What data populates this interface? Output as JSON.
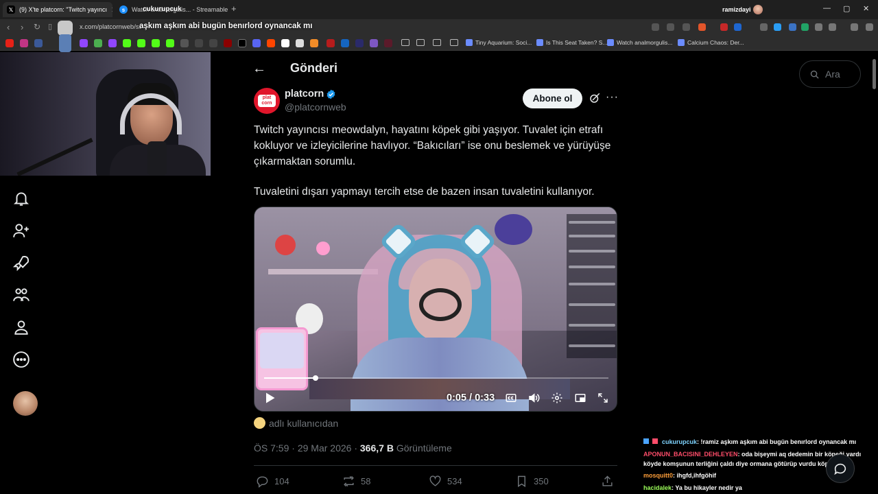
{
  "browser": {
    "tabs": [
      {
        "title": "(9) X'te platcorn: \"Twitch yayıncı",
        "favicon": "x-logo-icon",
        "active": true
      },
      {
        "title": "Watch analmorgulis... - Streamable",
        "favicon": "streamable-icon",
        "active": false
      }
    ],
    "new_tab_label": "+",
    "profile_name": "ramizdayi",
    "window_controls": [
      "—",
      "▢",
      "✕"
    ],
    "url": "x.com/platcornweb/st",
    "bookmarks": [
      {
        "label": "Tiny Aquarium: Soci..."
      },
      {
        "label": "Is This Seat Taken? S..."
      },
      {
        "label": "Watch analmorgulis..."
      },
      {
        "label": "Calcium Chaos: Der..."
      }
    ]
  },
  "stream_overlay": {
    "streamer": "cukurupcuk",
    "title": "aşkım aşkım abi bugün benırlord oynancak mı"
  },
  "sidebar": {
    "items": [
      {
        "name": "notifications",
        "icon": "bell-icon"
      },
      {
        "name": "follow",
        "icon": "add-person-icon"
      },
      {
        "name": "premium",
        "icon": "rocket-icon"
      },
      {
        "name": "communities",
        "icon": "people-icon"
      },
      {
        "name": "profile",
        "icon": "person-icon"
      },
      {
        "name": "more",
        "icon": "more-circle-icon"
      }
    ]
  },
  "header": {
    "title": "Gönderi"
  },
  "tweet": {
    "author_name": "platcorn",
    "author_handle": "@platcornweb",
    "avatar_text": "plat corn",
    "subscribe_label": "Abone ol",
    "paragraph_1": "Twitch yayıncısı meowdalyn, hayatını köpek gibi yaşıyor. Tuvalet için etrafı kokluyor ve izleyicilerine havlıyor. “Bakıcıları” ise onu beslemek ve yürüyüşe çıkarmaktan sorumlu.",
    "paragraph_2": "Tuvaletini dışarı yapmayı tercih etse de bazen insan tuvaletini kullanıyor.",
    "video_time": "0:05 / 0:33",
    "video_progress": 0.15,
    "from_user": "adlı kullanıcıdan",
    "time": "ÖS 7:59",
    "date": "29 Mar 2026",
    "views_count": "366,7 B",
    "views_label": "Görüntüleme",
    "replies": "104",
    "reposts": "58",
    "likes": "534",
    "bookmarks": "350"
  },
  "search": {
    "placeholder": "Ara"
  },
  "chat": [
    {
      "user": "cukurupcuk",
      "user_color": "#7fd4ff",
      "text": ": !ramiz aşkım aşkım abi bugün benırlord oynancak mı"
    },
    {
      "user": "APONUN_BACISINI_DEHLEYEN",
      "user_color": "#ff4d6a",
      "text": ": oda bişeymi aq dedemin bir köpeği vardı köyde komşunun terliğini çaldı diye ormana götürüp vurdu köpeği"
    },
    {
      "user": "mosquitt0",
      "user_color": "#ff9f3a",
      "text": ": ihgfd,ihfgöhif"
    },
    {
      "user": "hacidalek",
      "user_color": "#9dff5a",
      "text": ": Ya bu hikayler nedir ya"
    }
  ],
  "colors": {
    "verified": "#1d9bf0",
    "brand_red": "#e0162b",
    "muted": "#71767b"
  }
}
